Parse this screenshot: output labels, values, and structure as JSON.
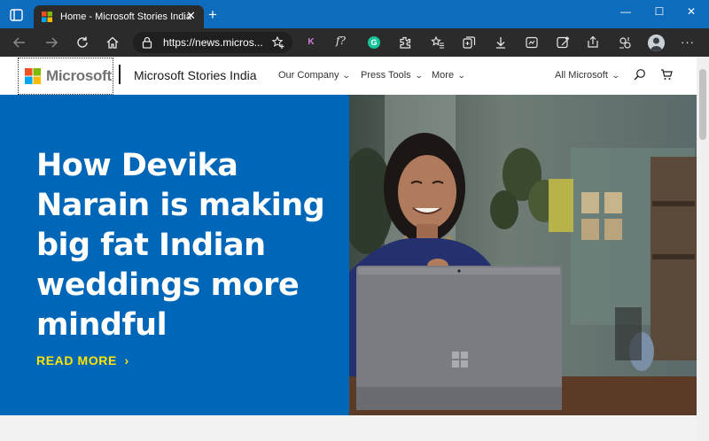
{
  "browser": {
    "tab": {
      "title": "Home - Microsoft Stories India",
      "close_glyph": "✕"
    },
    "new_tab_glyph": "+",
    "window_controls": {
      "minimize": "—",
      "maximize": "☐",
      "close": "✕"
    },
    "address": {
      "url": "https://news.micros..."
    },
    "extensions": {
      "k": "K",
      "f": "f?",
      "grammarly": "G"
    },
    "menu_glyph": "···"
  },
  "site": {
    "logo_text": "Microsoft",
    "title": "Microsoft Stories India",
    "nav": [
      {
        "label": "Our Company"
      },
      {
        "label": "Press Tools"
      },
      {
        "label": "More"
      },
      {
        "label": "All Microsoft"
      }
    ],
    "chevron": "⌄"
  },
  "hero": {
    "headline": "How Devika Narain is making big fat Indian weddings more mindful",
    "read_more": "READ MORE",
    "read_more_chevron": "›"
  },
  "colors": {
    "tabstrip": "#0f6cbd",
    "chrome_dark": "#2b2b2b",
    "hero_blue": "#0067b8",
    "read_more_yellow": "#ffe600"
  },
  "icons": {
    "toolbar": [
      "back-icon",
      "forward-icon",
      "refresh-icon",
      "home-icon",
      "lock-icon",
      "add-favorite-icon",
      "favorites-icon",
      "collections-icon",
      "downloads-icon",
      "screenshot-icon",
      "web-capture-icon",
      "share-icon",
      "extensions-icon",
      "profile-icon",
      "menu-icon"
    ],
    "header": [
      "search-icon",
      "cart-icon"
    ]
  }
}
